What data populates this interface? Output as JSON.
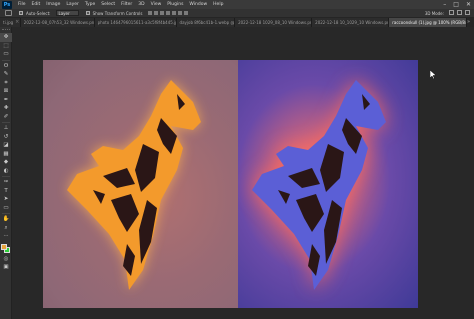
{
  "app": {
    "logo": "Ps",
    "menu": [
      "File",
      "Edit",
      "Image",
      "Layer",
      "Type",
      "Select",
      "Filter",
      "3D",
      "View",
      "Plugins",
      "Window",
      "Help"
    ],
    "window_controls": [
      "–",
      "□",
      "✕"
    ]
  },
  "options": {
    "auto_select_label": "Auto-Select:",
    "layer_select": "Layer",
    "show_transform_label": "Show Transform Controls",
    "mode_3d_label": "3D Mode:"
  },
  "tabs": [
    {
      "label": "ti.jpg",
      "active": false
    },
    {
      "label": "2022-12-08_07h53_32 Windows.png",
      "active": false
    },
    {
      "label": "photo 1464796015611-a3c5f8f4b445.jpg",
      "active": false
    },
    {
      "label": "dayjob 8f6bc41b-1.webp @",
      "active": false
    },
    {
      "label": "2022-12-18 1029_08_10 Windows.png",
      "active": false
    },
    {
      "label": "2022-12-18 10_1029_10 Windows.png",
      "active": false
    },
    {
      "label": "raccoonskull (1).jpg @ 100% (RGB/8#)",
      "active": true
    }
  ],
  "tab_overflow": "»",
  "toolbar": {
    "tools": [
      {
        "name": "move-tool-icon",
        "glyph": "✥",
        "selected": true
      },
      {
        "name": "artboard-tool-icon",
        "glyph": "⬚",
        "selected": false
      },
      {
        "name": "marquee-tool-icon",
        "glyph": "▭",
        "selected": false
      },
      {
        "name": "lasso-tool-icon",
        "glyph": "ʘ",
        "selected": false
      },
      {
        "name": "quick-select-tool-icon",
        "glyph": "✎",
        "selected": false
      },
      {
        "name": "crop-tool-icon",
        "glyph": "⌗",
        "selected": false
      },
      {
        "name": "frame-tool-icon",
        "glyph": "⊠",
        "selected": false
      },
      {
        "name": "eyedropper-tool-icon",
        "glyph": "✒",
        "selected": false
      },
      {
        "name": "healing-brush-tool-icon",
        "glyph": "✚",
        "selected": false
      },
      {
        "name": "brush-tool-icon",
        "glyph": "✐",
        "selected": false
      },
      {
        "name": "clone-stamp-tool-icon",
        "glyph": "⊥",
        "selected": false
      },
      {
        "name": "history-brush-tool-icon",
        "glyph": "↺",
        "selected": false
      },
      {
        "name": "eraser-tool-icon",
        "glyph": "◪",
        "selected": false
      },
      {
        "name": "gradient-tool-icon",
        "glyph": "▦",
        "selected": false
      },
      {
        "name": "blur-tool-icon",
        "glyph": "◆",
        "selected": false
      },
      {
        "name": "dodge-tool-icon",
        "glyph": "◐",
        "selected": false
      },
      {
        "name": "pen-tool-icon",
        "glyph": "✑",
        "selected": false
      },
      {
        "name": "type-tool-icon",
        "glyph": "T",
        "selected": false
      },
      {
        "name": "path-select-tool-icon",
        "glyph": "➤",
        "selected": false
      },
      {
        "name": "shape-tool-icon",
        "glyph": "▭",
        "selected": false
      },
      {
        "name": "hand-tool-icon",
        "glyph": "✋",
        "selected": false
      },
      {
        "name": "zoom-tool-icon",
        "glyph": "⌕",
        "selected": false
      },
      {
        "name": "more-tools-icon",
        "glyph": "···",
        "selected": false
      }
    ],
    "foreground_color": "#e8a43c",
    "background_color": "#2ed13a",
    "extra": [
      {
        "name": "quick-mask-icon",
        "glyph": "◎"
      },
      {
        "name": "screen-mode-icon",
        "glyph": "▣"
      }
    ]
  },
  "canvas": {
    "left_panel_tint": "#9a6a74",
    "wolf_left_fill": "#f39a2c",
    "wolf_left_glow": "#ffb050",
    "right_panel_tint": "#3f3a97",
    "wolf_right_fill": "#5b5fd6",
    "wolf_right_glow": "#ff6a5a",
    "wolf_markings": "#2a1616"
  }
}
